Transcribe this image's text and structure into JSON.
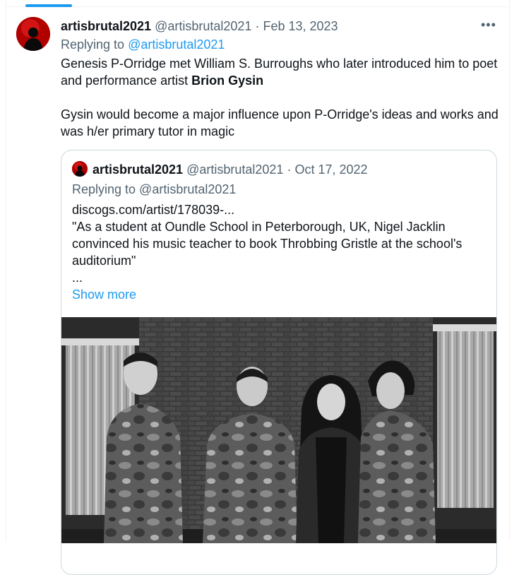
{
  "tweet": {
    "display_name": "artisbrutal2021",
    "handle": "@artisbrutal2021",
    "separator": "·",
    "date": "Feb 13, 2023",
    "replying_to_prefix": "Replying to",
    "replying_to_handle": "@artisbrutal2021",
    "more_icon": "more-horizontal-icon",
    "text_line1_a": "Genesis P-Orridge met  William S. Burroughs who later introduced him to poet and performance artist ",
    "text_line1_bold": "Brion Gysin",
    "text_para2": "Gysin would become a major influence upon P-Orridge's ideas and works and was h/er primary tutor in magic"
  },
  "quoted": {
    "display_name": "artisbrutal2021",
    "handle": "@artisbrutal2021",
    "separator": "·",
    "date": "Oct 17, 2022",
    "replying_to": "Replying to @artisbrutal2021",
    "link": "discogs.com/artist/178039-...",
    "quote_text": "\"As a student at Oundle School in Peterborough, UK, Nigel Jacklin convinced his music teacher to book Throbbing Gristle at the school's auditorium\"",
    "ellipsis": "...",
    "show_more": "Show more"
  },
  "colors": {
    "accent": "#1d9bf0",
    "text_primary": "#0f1419",
    "text_secondary": "#536471",
    "border": "#cfd9de",
    "avatar_red": "#b00000"
  }
}
